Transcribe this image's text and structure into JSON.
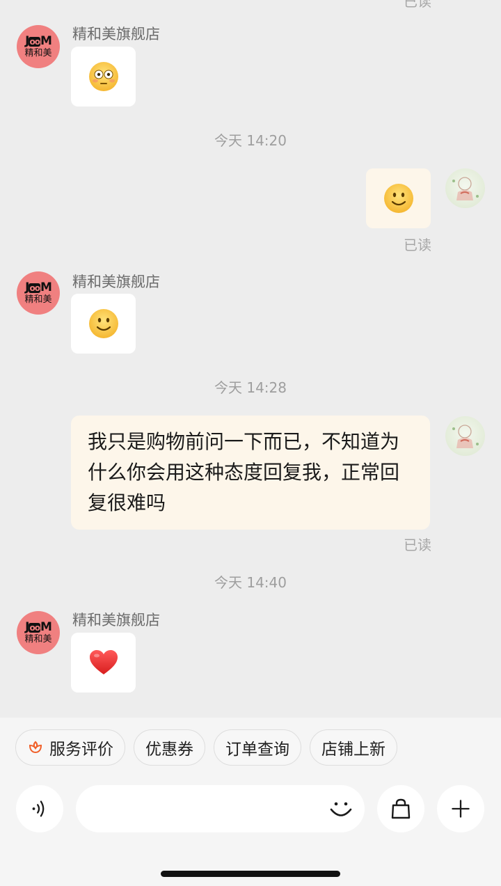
{
  "shop_name": "精和美旗舰店",
  "shop_logo_text": "JooM 精和美",
  "read_status": "已读",
  "messages": [
    {
      "type": "incoming_emoji",
      "sender": "精和美旗舰店",
      "emoji": "flushed-face-icon"
    },
    {
      "type": "timestamp",
      "text": "今天 14:20"
    },
    {
      "type": "outgoing_emoji",
      "emoji": "slightly-smiling-face-icon",
      "status": "已读"
    },
    {
      "type": "incoming_emoji",
      "sender": "精和美旗舰店",
      "emoji": "slightly-smiling-face-icon"
    },
    {
      "type": "timestamp",
      "text": "今天 14:28"
    },
    {
      "type": "outgoing_text",
      "text": "我只是购物前问一下而已，不知道为什么你会用这种态度回复我，正常回复很难吗",
      "status": "已读"
    },
    {
      "type": "timestamp",
      "text": "今天 14:40"
    },
    {
      "type": "incoming_emoji",
      "sender": "精和美旗舰店",
      "emoji": "red-heart-icon"
    }
  ],
  "quick_actions": [
    {
      "label": "服务评价",
      "icon": "flower-icon"
    },
    {
      "label": "优惠券"
    },
    {
      "label": "订单查询"
    },
    {
      "label": "店铺上新"
    }
  ],
  "input": {
    "placeholder": ""
  },
  "colors": {
    "background": "#ededed",
    "outgoing_bubble": "#fdf6ea",
    "incoming_bubble": "#ffffff",
    "shop_avatar": "#f08080",
    "accent": "#f0602a"
  }
}
